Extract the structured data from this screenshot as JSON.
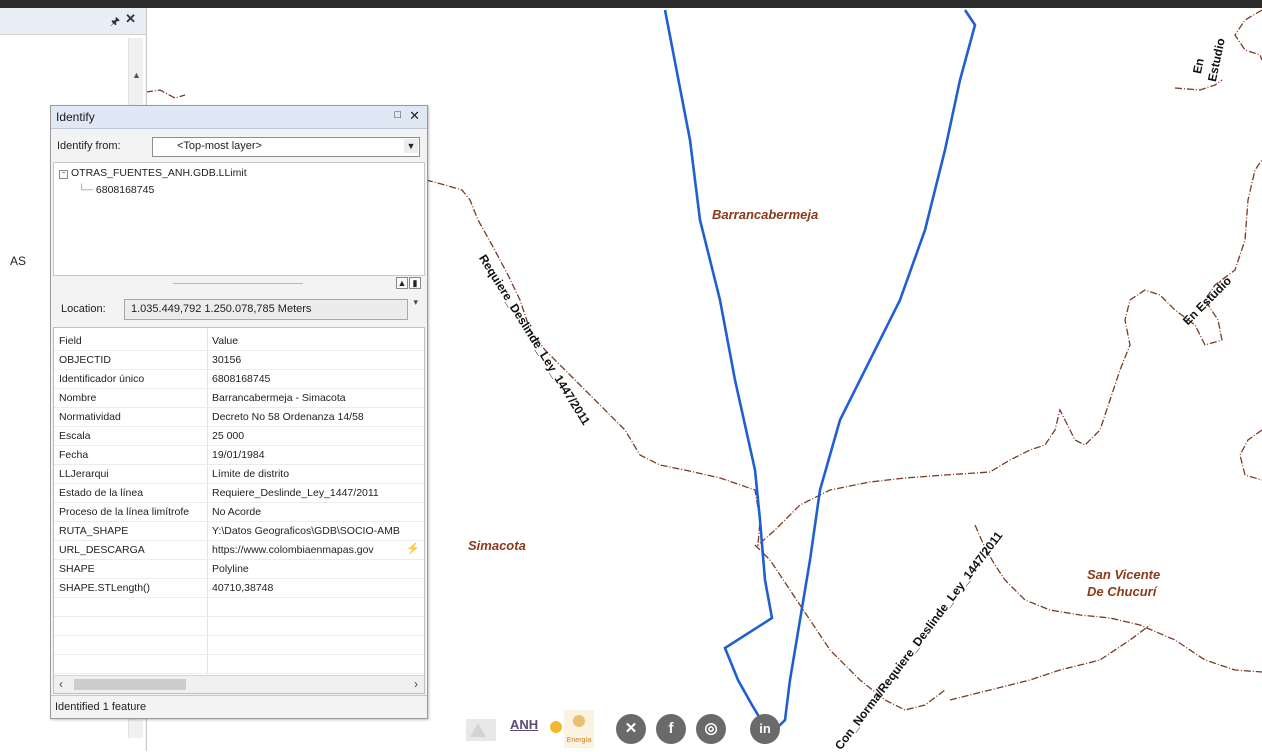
{
  "map": {
    "regions": {
      "barrancabermeja": "Barrancabermeja",
      "simacota": "Simacota",
      "san_vicente_line1": "San Vicente",
      "san_vicente_line2": "De Chucurí"
    },
    "boundary_labels": {
      "top_en_estudio_1": "En",
      "top_en_estudio_2": "Estudio",
      "right_en_estudio": "En Estudio",
      "requiere_deslinde": "Requiere_Deslinde_Ley_1447/2011",
      "con_norma": "Con_Norma/Requiere_Deslinde_Ley_1447/2011"
    },
    "colors": {
      "boundary": "#7a3a24",
      "selected_feature": "#1f5fd0",
      "region_label": "#8b3a1a"
    }
  },
  "dock": {
    "pin_icon": "pin-icon",
    "close_glyph": "✕",
    "partial_text": "AS"
  },
  "identify": {
    "title": "Identify",
    "from_label": "Identify from:",
    "from_value": "<Top-most layer>",
    "tree": {
      "layer": "OTRAS_FUENTES_ANH.GDB.LLimit",
      "feature": "6808168745"
    },
    "location_label": "Location:",
    "location_value": "1.035.449,792  1.250.078,785 Meters",
    "columns": {
      "field": "Field",
      "value": "Value"
    },
    "rows": [
      {
        "field": "OBJECTID",
        "value": "30156"
      },
      {
        "field": "Identificador único",
        "value": "6808168745"
      },
      {
        "field": "Nombre",
        "value": "Barrancabermeja - Simacota"
      },
      {
        "field": "Normatividad",
        "value": "Decreto No 58 Ordenanza 14/58"
      },
      {
        "field": "Escala",
        "value": "25 000"
      },
      {
        "field": "Fecha",
        "value": "19/01/1984"
      },
      {
        "field": "LLJerarqui",
        "value": "Límite de distrito"
      },
      {
        "field": "Estado de la línea",
        "value": "Requiere_Deslinde_Ley_1447/2011"
      },
      {
        "field": "Proceso de la línea limítrofe",
        "value": "No Acorde"
      },
      {
        "field": "RUTA_SHAPE",
        "value": "Y:\\Datos Geograficos\\GDB\\SOCIO-AMB"
      },
      {
        "field": "URL_DESCARGA",
        "value": "https://www.colombiaenmapas.gov"
      },
      {
        "field": "SHAPE",
        "value": "Polyline"
      },
      {
        "field": "SHAPE.STLength()",
        "value": "40710,38748"
      }
    ],
    "status": "Identified 1 feature"
  },
  "logos": {
    "anh": "ANH",
    "energia": "Energía",
    "social": [
      "x-icon",
      "facebook-icon",
      "instagram-icon",
      "linkedin-icon"
    ]
  }
}
